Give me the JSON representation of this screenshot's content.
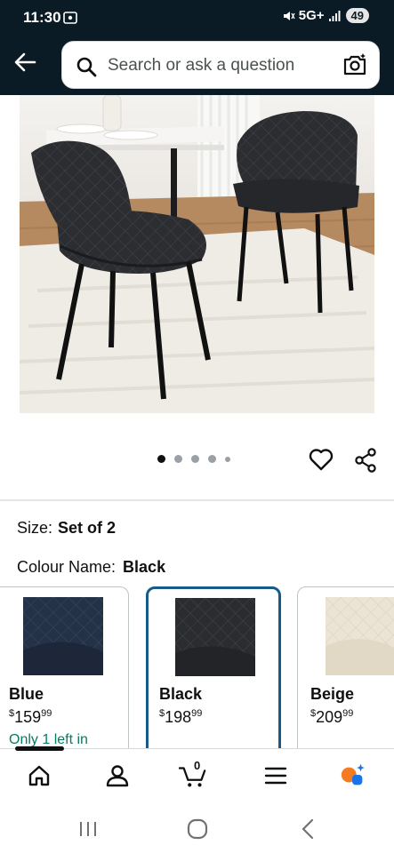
{
  "status_bar": {
    "time": "11:30",
    "network": "5G+",
    "battery": "49"
  },
  "search": {
    "placeholder": "Search or ask a question"
  },
  "carousel": {
    "total_dots": 5,
    "active_index": 0
  },
  "product": {
    "size_label": "Size:",
    "size_value": "Set of 2",
    "colour_label": "Colour Name:",
    "colour_value": "Black"
  },
  "swatches": [
    {
      "name": "Blue",
      "price_symbol": "$",
      "price_whole": "159",
      "price_fraction": "99",
      "note": "Only 1 left in",
      "color": "#243247"
    },
    {
      "name": "Black",
      "price_symbol": "$",
      "price_whole": "198",
      "price_fraction": "99",
      "note": "",
      "color": "#2a2c30"
    },
    {
      "name": "Beige",
      "price_symbol": "$",
      "price_whole": "209",
      "price_fraction": "99",
      "note": "",
      "color": "#e8e0d2"
    }
  ],
  "bottom_nav": {
    "cart_count": "0",
    "items": [
      "home-icon",
      "account-icon",
      "cart-icon",
      "menu-icon",
      "rufus-icon"
    ],
    "accent": "#f47b20"
  },
  "colors": {
    "top_bar": "#0b1b26",
    "selected_border": "#1a5a8a",
    "stock_green": "#067d62"
  }
}
